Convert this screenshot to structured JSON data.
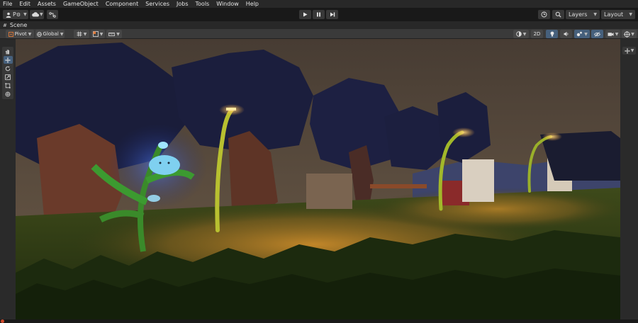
{
  "menu": {
    "items": [
      "File",
      "Edit",
      "Assets",
      "GameObject",
      "Component",
      "Services",
      "Jobs",
      "Tools",
      "Window",
      "Help"
    ]
  },
  "toolbar": {
    "account_label": "P",
    "layers_label": "Layers",
    "layout_label": "Layout"
  },
  "scene_tab": {
    "title": "Scene"
  },
  "scene_toolbar": {
    "pivot_label": "Pivot",
    "global_label": "Global",
    "mode_2d_label": "2D"
  },
  "colors": {
    "accent_active": "#46607c",
    "menu_bg": "#282828",
    "toolbar_bg": "#191919",
    "panel_bg": "#3a3a3a"
  },
  "icons": {
    "account": "person-icon",
    "cloud": "cloud-icon",
    "collab": "collab-icon",
    "play": "play-icon",
    "pause": "pause-icon",
    "step": "step-icon",
    "history": "history-icon",
    "search": "search-icon"
  }
}
